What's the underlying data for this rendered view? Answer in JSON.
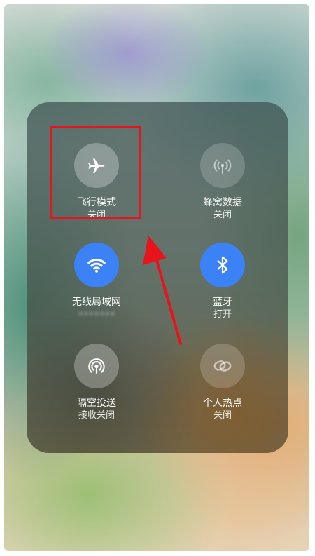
{
  "colors": {
    "accent_on": "#3b82f6",
    "highlight": "#e8141c"
  },
  "tiles": {
    "airplane": {
      "label": "飞行模式",
      "status": "关闭",
      "icon": "airplane-icon",
      "state": "off"
    },
    "cellular": {
      "label": "蜂窝数据",
      "status": "关闭",
      "icon": "cellular-antenna-icon",
      "state": "off"
    },
    "wifi": {
      "label": "无线局域网",
      "status": "•••••••",
      "icon": "wifi-icon",
      "state": "on"
    },
    "bluetooth": {
      "label": "蓝牙",
      "status": "打开",
      "icon": "bluetooth-icon",
      "state": "on"
    },
    "airdrop": {
      "label": "隔空投送",
      "status": "接收关闭",
      "icon": "airdrop-icon",
      "state": "off"
    },
    "hotspot": {
      "label": "个人热点",
      "status": "关闭",
      "icon": "hotspot-link-icon",
      "state": "dim"
    }
  }
}
